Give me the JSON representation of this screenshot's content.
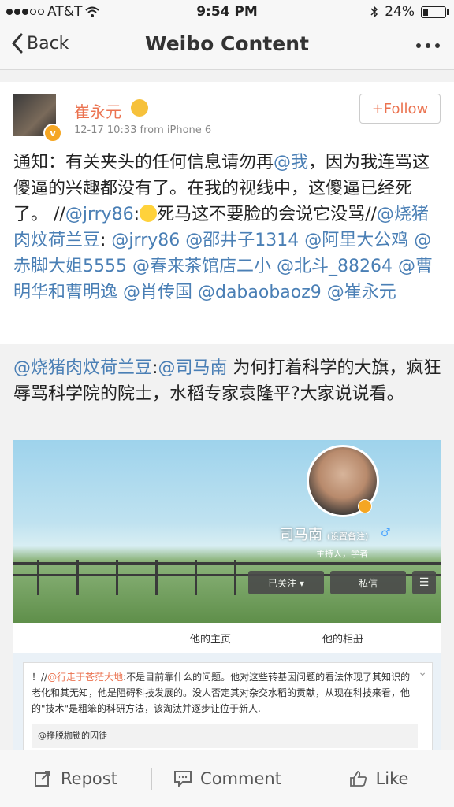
{
  "status_bar": {
    "carrier": "AT&T",
    "time": "9:54 PM",
    "battery": "24%"
  },
  "nav": {
    "back_label": "Back",
    "title": "Weibo Content"
  },
  "post": {
    "user_name": "崔永元",
    "time": "12-17 10:33",
    "source": "from iPhone 6",
    "follow_label": "+Follow",
    "text_parts": [
      {
        "t": "通知：有关夹头的任何信息请勿再",
        "m": false
      },
      {
        "t": "@我",
        "m": true
      },
      {
        "t": "，因为我连骂这傻逼的兴趣都没有了。在我的视线中，这傻逼已经死了。 //",
        "m": false
      },
      {
        "t": "@jrry86",
        "m": true
      },
      {
        "t": ":",
        "m": false
      },
      {
        "t": "死马这不要脸的会说它没骂//",
        "m": false
      },
      {
        "t": "@烧猪肉炆荷兰豆",
        "m": true
      },
      {
        "t": ": ",
        "m": false
      },
      {
        "t": "@jrry86 @邵井子1314 @阿里大公鸡 @赤脚大姐5555 @春来茶馆店二小 @北斗_88264 @曹明华和曹明逸 @肖传国 @dabaobaoz9 @崔永元",
        "m": true
      }
    ]
  },
  "repost": {
    "mention1": "@烧猪肉炆荷兰豆",
    "sep": ":",
    "mention2": "@司马南",
    "text": " 为何打着科学的大旗，疯狂辱骂科学院的院士，水稻专家袁隆平?大家说说看。",
    "profile": {
      "name": "司马南",
      "note": "(设置备注)",
      "desc": "主持人，学者",
      "followed_label": "已关注 ▾",
      "message_label": "私信",
      "tab_home": "他的主页",
      "tab_album": "他的相册"
    },
    "comment": {
      "prefix": "！//",
      "mention": "@行走于苍茫大地",
      "text": ":不是目前靠什么的问题。他对这些转基因问题的看法体现了其知识的老化和其无知，他是阻碍科技发展的。没人否定其对杂交水稻的贡献，从现在科技来看，他的\"技术\"是粗笨的科研方法，该淘汰并逐步让位于新人.",
      "sub": "@挣脱枷锁的囚徒"
    }
  },
  "toolbar": {
    "repost": "Repost",
    "comment": "Comment",
    "like": "Like"
  },
  "colors": {
    "orange": "#eb7350",
    "link": "#4a7fb5"
  }
}
